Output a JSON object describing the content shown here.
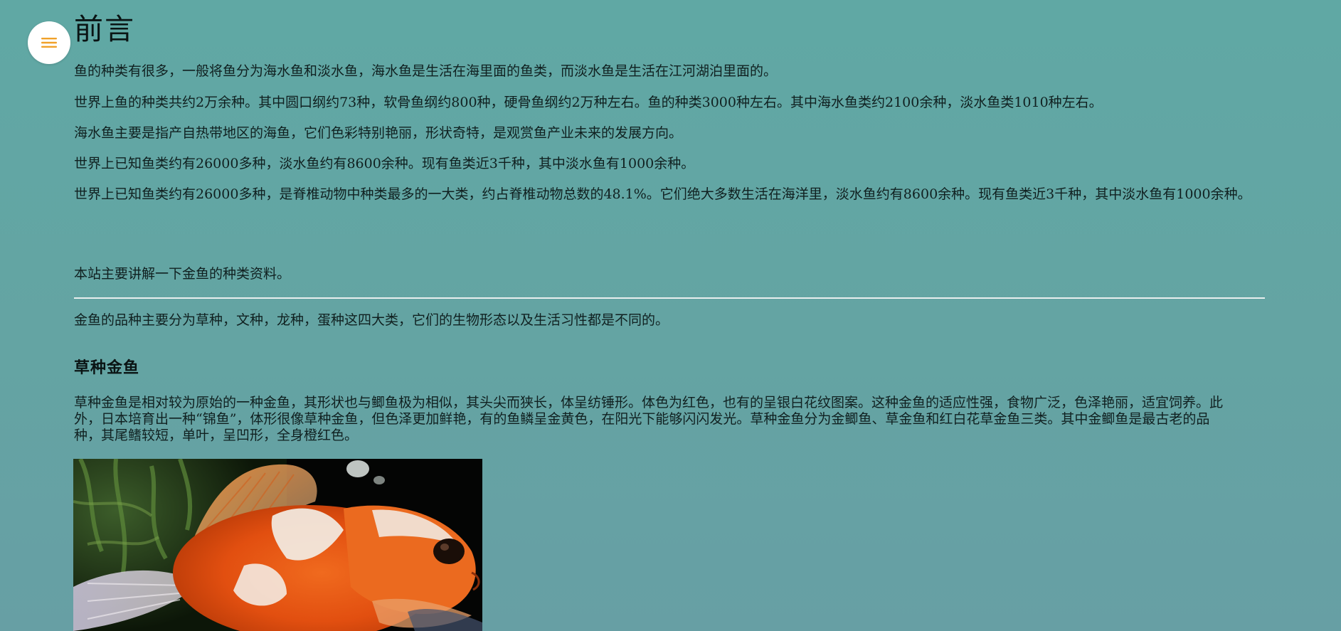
{
  "menu": {
    "icon": "hamburger-menu-icon",
    "icon_color": "#f0a12a",
    "button_bg": "#ffffff"
  },
  "page": {
    "title": "前言",
    "background": "#62a8a4"
  },
  "paragraphs": {
    "p1": "鱼的种类有很多，一般将鱼分为海水鱼和淡水鱼，海水鱼是生活在海里面的鱼类，而淡水鱼是生活在江河湖泊里面的。",
    "p2": "世界上鱼的种类共约2万余种。其中圆口纲约73种，软骨鱼纲约800种，硬骨鱼纲约2万种左右。鱼的种类3000种左右。其中海水鱼类约2100余种，淡水鱼类1010种左右。",
    "p3": "海水鱼主要是指产自热带地区的海鱼，它们色彩特别艳丽，形状奇特，是观赏鱼产业未来的发展方向。",
    "p4": "世界上已知鱼类约有26000多种，淡水鱼约有8600余种。现有鱼类近3千种，其中淡水鱼有1000余种。",
    "p5": "世界上已知鱼类约有26000多种，是脊椎动物中种类最多的一大类，约占脊椎动物总数的48.1%。它们绝大多数生活在海洋里，淡水鱼约有8600余种。现有鱼类近3千种，其中淡水鱼有1000余种。",
    "p6": "本站主要讲解一下金鱼的种类资料。"
  },
  "goldfish": {
    "intro": "金鱼的品种主要分为草种，文种，龙种，蛋种这四大类，它们的生物形态以及生活习性都是不同的。",
    "section_title": "草种金鱼",
    "section_body": "草种金鱼是相对较为原始的一种金鱼，其形状也与鲫鱼极为相似，其头尖而狭长，体呈纺锤形。体色为红色，也有的呈银白花纹图案。这种金鱼的适应性强，食物广泛，色泽艳丽，适宜饲养。此外，日本培育出一种“锦鱼”，体形很像草种金鱼，但色泽更加鲜艳，有的鱼鳞呈金黄色，在阳光下能够闪闪发光。草种金鱼分为金鲫鱼、草金鱼和红白花草金鱼三类。其中金鲫鱼是最古老的品种，其尾鳍较短，单叶，呈凹形，全身橙红色。"
  }
}
